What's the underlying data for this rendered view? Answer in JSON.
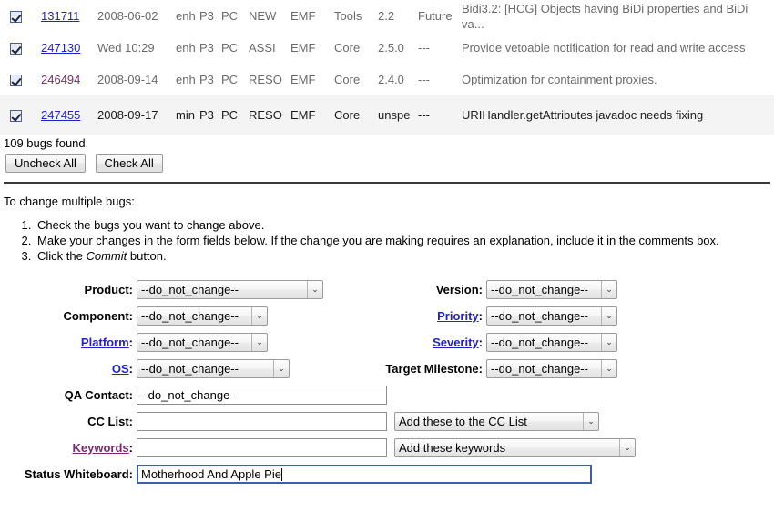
{
  "buglist": {
    "rows": [
      {
        "checked": true,
        "id": "131711",
        "visited": false,
        "changed": "2008-06-02",
        "severity": "enh",
        "priority": "P3",
        "platform": "PC",
        "status": "NEW",
        "product": "EMF",
        "component": "Tools",
        "version": "2.2",
        "milestone": "Future",
        "summary": "Bidi3.2: [HCG] Objects having BiDi properties and BiDi va..."
      },
      {
        "checked": true,
        "id": "247130",
        "visited": false,
        "changed": "Wed 10:29",
        "severity": "enh",
        "priority": "P3",
        "platform": "PC",
        "status": "ASSI",
        "product": "EMF",
        "component": "Core",
        "version": "2.5.0",
        "milestone": "---",
        "summary": "Provide vetoable notification for read and write access"
      },
      {
        "checked": true,
        "id": "246494",
        "visited": true,
        "changed": "2008-09-14",
        "severity": "enh",
        "priority": "P3",
        "platform": "PC",
        "status": "RESO",
        "product": "EMF",
        "component": "Core",
        "version": "2.4.0",
        "milestone": "---",
        "summary": "Optimization for containment proxies."
      },
      {
        "checked": true,
        "id": "247455",
        "visited": false,
        "changed": "2008-09-17",
        "severity": "min",
        "priority": "P3",
        "platform": "PC",
        "status": "RESO",
        "product": "EMF",
        "component": "Core",
        "version": "unspe",
        "milestone": "---",
        "summary": "URIHandler.getAttributes javadoc needs fixing"
      }
    ],
    "found_text": "109 bugs found.",
    "uncheck_all_label": "Uncheck All",
    "check_all_label": "Check All"
  },
  "instructions": {
    "intro": "To change multiple bugs:",
    "step1": "Check the bugs you want to change above.",
    "step2": "Make your changes in the form fields below. If the change you are making requires an explanation, include it in the comments box.",
    "step3_before": "Click the ",
    "step3_emph": "Commit",
    "step3_after": " button."
  },
  "form": {
    "do_not_change": "--do_not_change--",
    "left": {
      "product_label": "Product:",
      "product_value": "--do_not_change--",
      "component_label": "Component:",
      "component_value": "--do_not_change--",
      "platform_label": "Platform",
      "platform_value": "--do_not_change--",
      "os_label": "OS",
      "os_value": "--do_not_change--",
      "qa_contact_label": "QA Contact:",
      "qa_contact_value": "--do_not_change--",
      "cc_list_label": "CC List:",
      "cc_list_value": "",
      "cc_action_value": "Add these to the CC List",
      "keywords_label": "Keywords",
      "keywords_value": "",
      "keywords_action_value": "Add these keywords",
      "status_whiteboard_label": "Status Whiteboard:",
      "status_whiteboard_value": "Motherhood And Apple Pie"
    },
    "right": {
      "version_label": "Version:",
      "version_value": "--do_not_change--",
      "priority_label": "Priority",
      "priority_value": "--do_not_change--",
      "severity_label": "Severity",
      "severity_value": "--do_not_change--",
      "target_milestone_label": "Target Milestone:",
      "target_milestone_value": "--do_not_change--"
    },
    "colon": ":",
    "arrow_glyph": "⌄"
  },
  "colors": {
    "link": "#2222cc",
    "visited_link": "#7a2a6e",
    "row_alt_bg": "#f4f4f4",
    "focus_border": "#3b5fa8",
    "muted_text": "#6a6a6a"
  }
}
